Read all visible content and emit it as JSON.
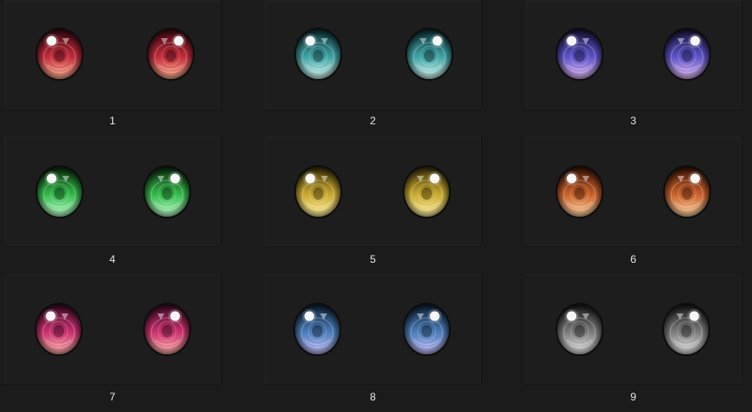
{
  "gallery": {
    "items": [
      {
        "label": "1",
        "colors": {
          "top": "#3a0a10",
          "mid": "#c02a3a",
          "bottom": "#ffb090"
        }
      },
      {
        "label": "2",
        "colors": {
          "top": "#0c2e33",
          "mid": "#3ea2a4",
          "bottom": "#d2f6ee"
        }
      },
      {
        "label": "3",
        "colors": {
          "top": "#1a1438",
          "mid": "#5a52c6",
          "bottom": "#e2b8f4"
        }
      },
      {
        "label": "4",
        "colors": {
          "top": "#0a2a0c",
          "mid": "#33b84a",
          "bottom": "#b8ffc8"
        }
      },
      {
        "label": "5",
        "colors": {
          "top": "#3a3008",
          "mid": "#c8a830",
          "bottom": "#fff2a0"
        }
      },
      {
        "label": "6",
        "colors": {
          "top": "#3a1406",
          "mid": "#c8602a",
          "bottom": "#ffd4a0"
        }
      },
      {
        "label": "7",
        "colors": {
          "top": "#3a0a24",
          "mid": "#c8306e",
          "bottom": "#ffb0a8"
        }
      },
      {
        "label": "8",
        "colors": {
          "top": "#0e2034",
          "mid": "#4a7cb8",
          "bottom": "#c2bcf8"
        }
      },
      {
        "label": "9",
        "colors": {
          "top": "#1a1a1a",
          "mid": "#7a7a7a",
          "bottom": "#e6e6e6"
        }
      }
    ]
  }
}
